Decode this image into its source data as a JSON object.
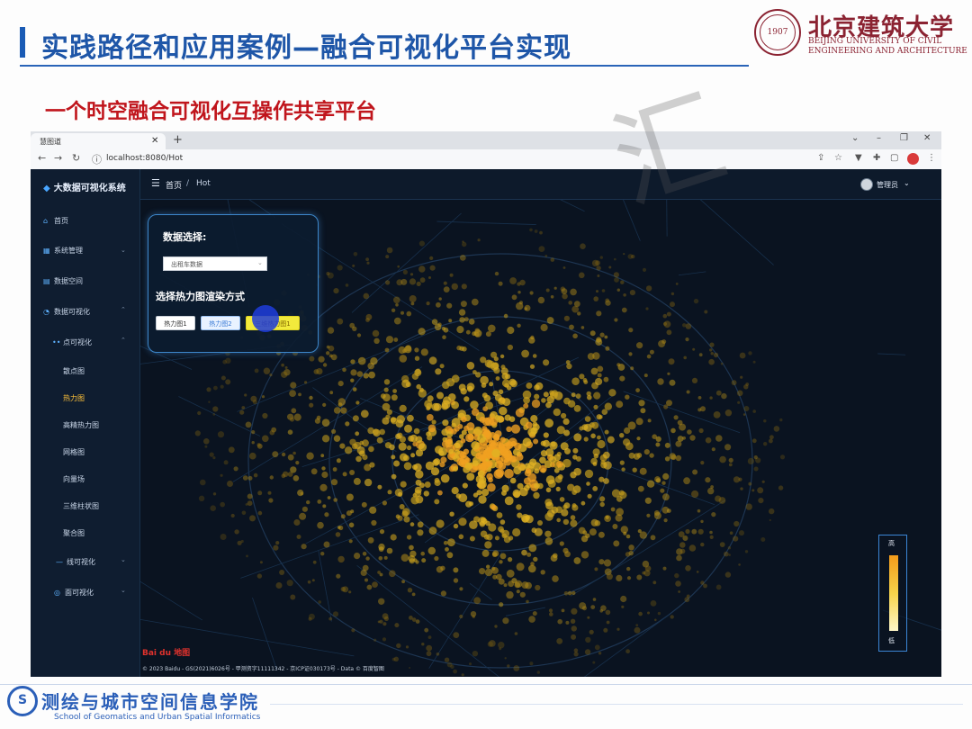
{
  "slide": {
    "title": "实践路径和应用案例—融合可视化平台实现",
    "subtitle": "一个时空融合可视化互操作共享平台",
    "university_cn": "北京建筑大学",
    "university_en_1": "BEIJING UNIVERSITY OF CIVIL",
    "university_en_2": "ENGINEERING AND ARCHITECTURE",
    "footer_cn": "测绘与城市空间信息学院",
    "footer_en": "School of Geomatics and Urban Spatial Informatics"
  },
  "browser": {
    "tab_title": "慧图道",
    "url": "localhost:8080/Hot"
  },
  "app": {
    "brand": "大数据可视化系统",
    "sidebar": [
      {
        "label": "首页",
        "icon": "home-icon"
      },
      {
        "label": "系统管理",
        "icon": "grid-icon"
      },
      {
        "label": "数据空间",
        "icon": "document-icon"
      },
      {
        "label": "数据可视化",
        "icon": "chart-icon"
      },
      {
        "label": "点可视化",
        "icon": "dots-icon"
      },
      {
        "label": "散点图"
      },
      {
        "label": "热力图",
        "active": true
      },
      {
        "label": "高精热力图"
      },
      {
        "label": "网格图"
      },
      {
        "label": "向量场"
      },
      {
        "label": "三维柱状图"
      },
      {
        "label": "聚合图"
      },
      {
        "label": "线可视化",
        "icon": "line-icon"
      },
      {
        "label": "面可视化",
        "icon": "polygon-icon"
      }
    ],
    "breadcrumb": {
      "home": "首页",
      "separator": "/",
      "current": "Hot"
    },
    "user": "管理员",
    "panel": {
      "heading_data": "数据选择:",
      "select_value": "出租车数据",
      "heading_render": "选择热力图渲染方式",
      "buttons": [
        "热力图1",
        "热力图2",
        "三维热力图1"
      ]
    },
    "legend": {
      "high": "高",
      "low": "低"
    },
    "map_logo": "Bai du 地图",
    "map_copyright": "© 2023 Baidu - GS(2021)6026号 - 甲测资字11111342 - 京ICP证030173号 - Data © 百度智图"
  },
  "colors": {
    "title_blue": "#1e56a8",
    "subtitle_red": "#c0151c",
    "brand_maroon": "#8b2332",
    "heat_hi": "#f39b1a",
    "heat_lo": "#fff6c8"
  }
}
